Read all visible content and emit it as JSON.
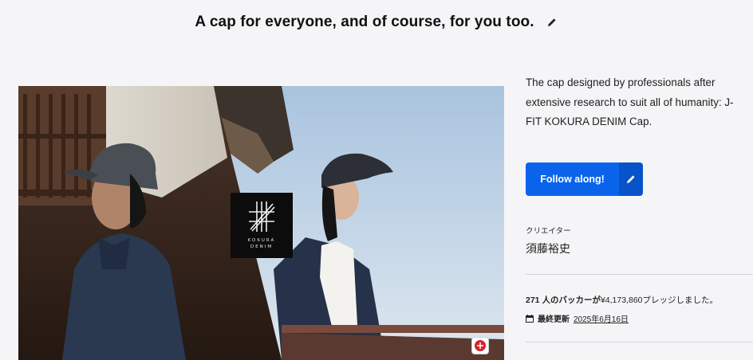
{
  "header": {
    "title": "A cap for everyone, and of course, for you too."
  },
  "hero": {
    "logo_line1": "KOKURA",
    "logo_line2": "DENIM"
  },
  "sidebar": {
    "description": "The cap designed by professionals after extensive research to suit all of humanity: J-FIT KOKURA DENIM Cap.",
    "follow_label": "Follow along!",
    "creator_label": "クリエイター",
    "creator_name": "須藤裕史",
    "backers_count": "271",
    "backers_text_pre": " 人のバッカーが",
    "backers_amount": "¥4,173,860",
    "backers_text_post": "プレッジしました。",
    "updated_label": "最終更新",
    "updated_date": "2025年6月16日"
  },
  "colors": {
    "accent": "#0a64eb",
    "accent_dark": "#0753c9"
  },
  "icons": [
    "pencil-icon",
    "calendar-icon",
    "kokura-denim-logo"
  ]
}
